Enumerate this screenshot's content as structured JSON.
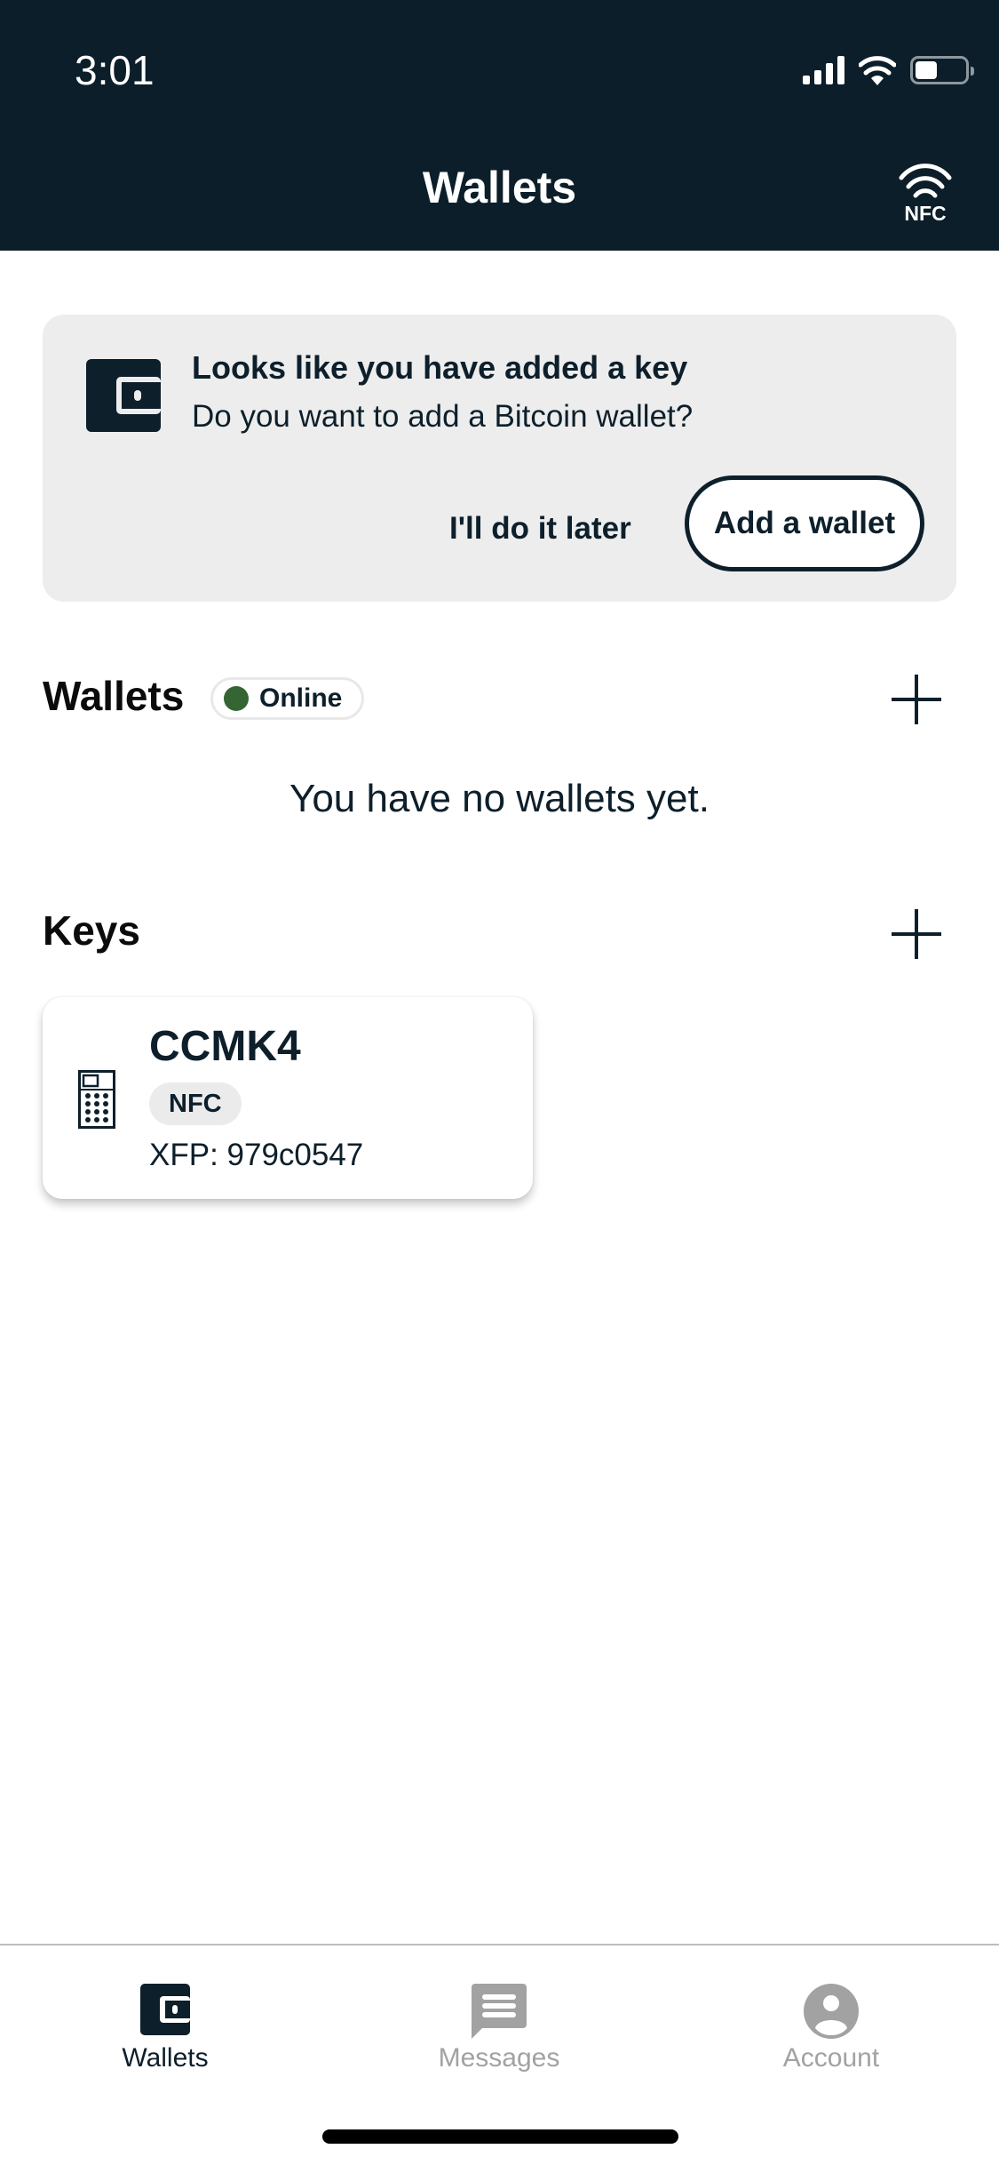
{
  "status_bar": {
    "time": "3:01",
    "battery_level": 0.45
  },
  "header": {
    "title": "Wallets",
    "nfc_label": "NFC"
  },
  "prompt_card": {
    "title": "Looks like you have added a key",
    "subtitle": "Do you want to add a Bitcoin wallet?",
    "later_label": "I'll do it later",
    "add_label": "Add a wallet"
  },
  "wallets_section": {
    "title": "Wallets",
    "status": "Online",
    "status_color": "#356532",
    "empty_text": "You have no wallets yet."
  },
  "keys_section": {
    "title": "Keys",
    "keys": [
      {
        "name": "CCMK4",
        "tag": "NFC",
        "xfp": "XFP: 979c0547"
      }
    ]
  },
  "tab_bar": {
    "tabs": [
      {
        "label": "Wallets",
        "icon": "wallet-icon",
        "active": true
      },
      {
        "label": "Messages",
        "icon": "message-icon",
        "active": false
      },
      {
        "label": "Account",
        "icon": "account-icon",
        "active": false
      }
    ],
    "active_color": "#0d1f2b",
    "inactive_color": "#a2a2a2"
  }
}
